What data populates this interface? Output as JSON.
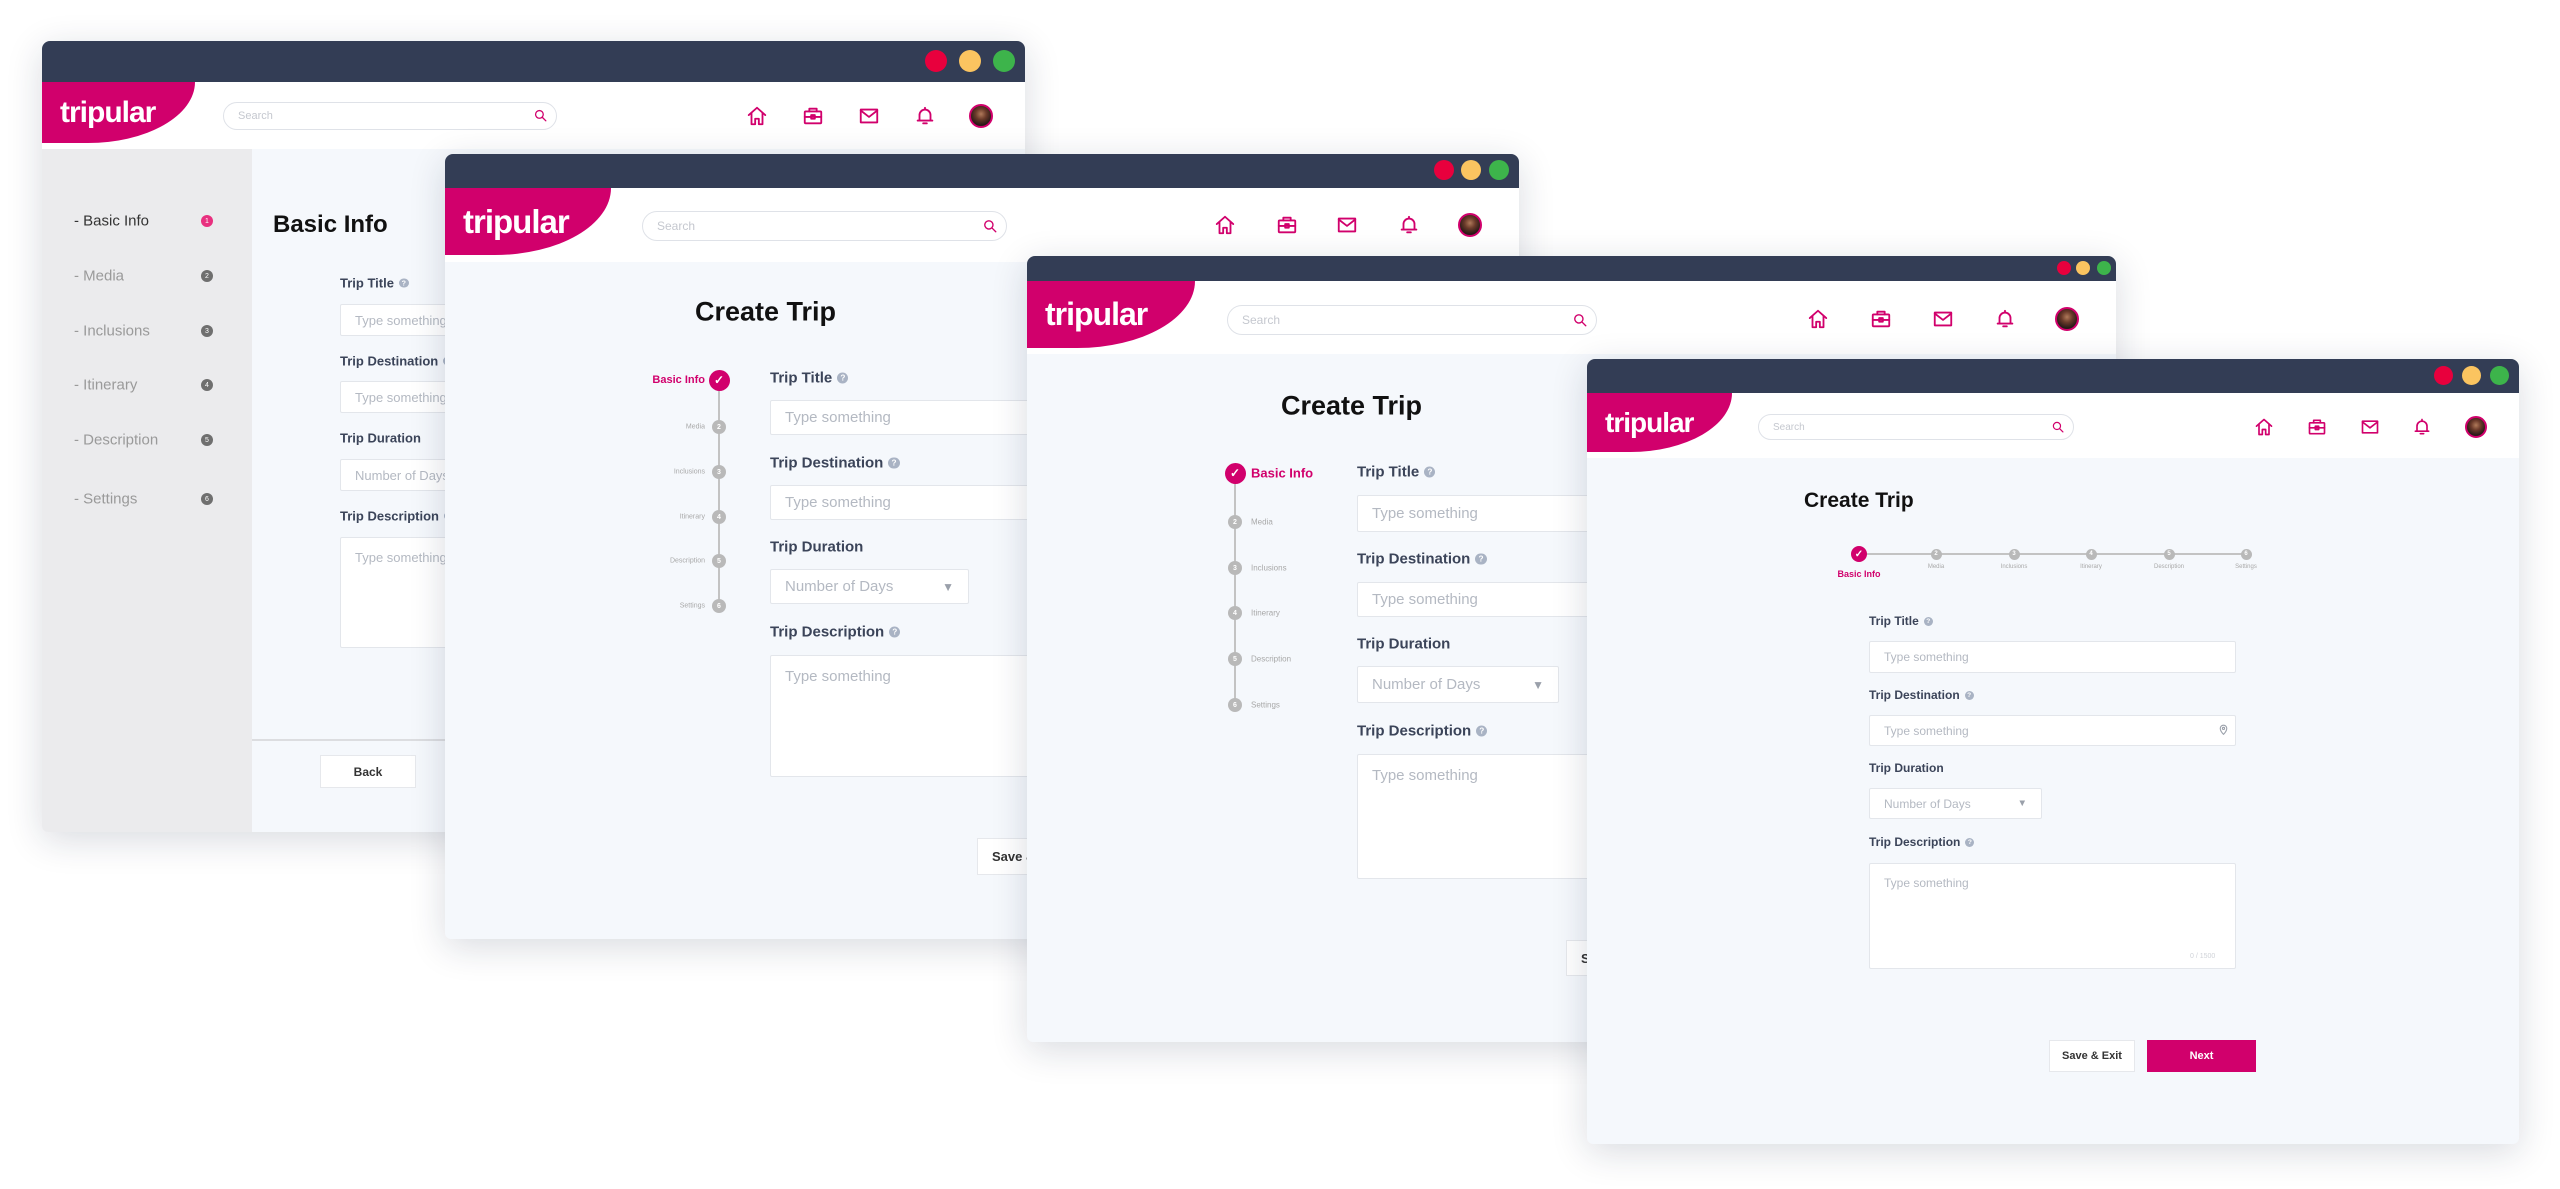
{
  "brand": {
    "logo": "tripular",
    "accent": "#d1006c",
    "titlebar": "#333d55"
  },
  "window_controls": {
    "close_color": "#e8003d",
    "minimize_color": "#fbc460",
    "maximize_color": "#3db44b"
  },
  "header": {
    "search_placeholder": "Search",
    "nav_icons": [
      "home-icon",
      "briefcase-icon",
      "mail-icon",
      "bell-icon"
    ],
    "avatar": "user-avatar"
  },
  "form": {
    "title_label": "Trip Title",
    "destination_label": "Trip Destination",
    "duration_label": "Trip Duration",
    "description_label": "Trip Description",
    "placeholder": "Type something",
    "duration_placeholder": "Number of Days",
    "description_counter": "0 / 1500",
    "help_glyph": "?"
  },
  "steps": [
    {
      "label": "Basic Info",
      "number": "1",
      "status": "active"
    },
    {
      "label": "Media",
      "number": "2",
      "status": "pending"
    },
    {
      "label": "Inclusions",
      "number": "3",
      "status": "pending"
    },
    {
      "label": "Itinerary",
      "number": "4",
      "status": "pending"
    },
    {
      "label": "Description",
      "number": "5",
      "status": "pending"
    },
    {
      "label": "Settings",
      "number": "6",
      "status": "pending"
    }
  ],
  "sidebar": {
    "items": [
      {
        "label": "- Basic Info",
        "number": "1"
      },
      {
        "label": "- Media",
        "number": "2"
      },
      {
        "label": "- Inclusions",
        "number": "3"
      },
      {
        "label": "- Itinerary",
        "number": "4"
      },
      {
        "label": "- Description",
        "number": "5"
      },
      {
        "label": "- Settings",
        "number": "6"
      }
    ]
  },
  "windows": [
    {
      "heading": "Basic Info",
      "back_label": "Back"
    },
    {
      "heading": "Create Trip",
      "save_label": "Save & Exit"
    },
    {
      "heading": "Create Trip",
      "save_label": "Save & Exit"
    },
    {
      "heading": "Create Trip",
      "save_label": "Save & Exit",
      "next_label": "Next"
    }
  ]
}
